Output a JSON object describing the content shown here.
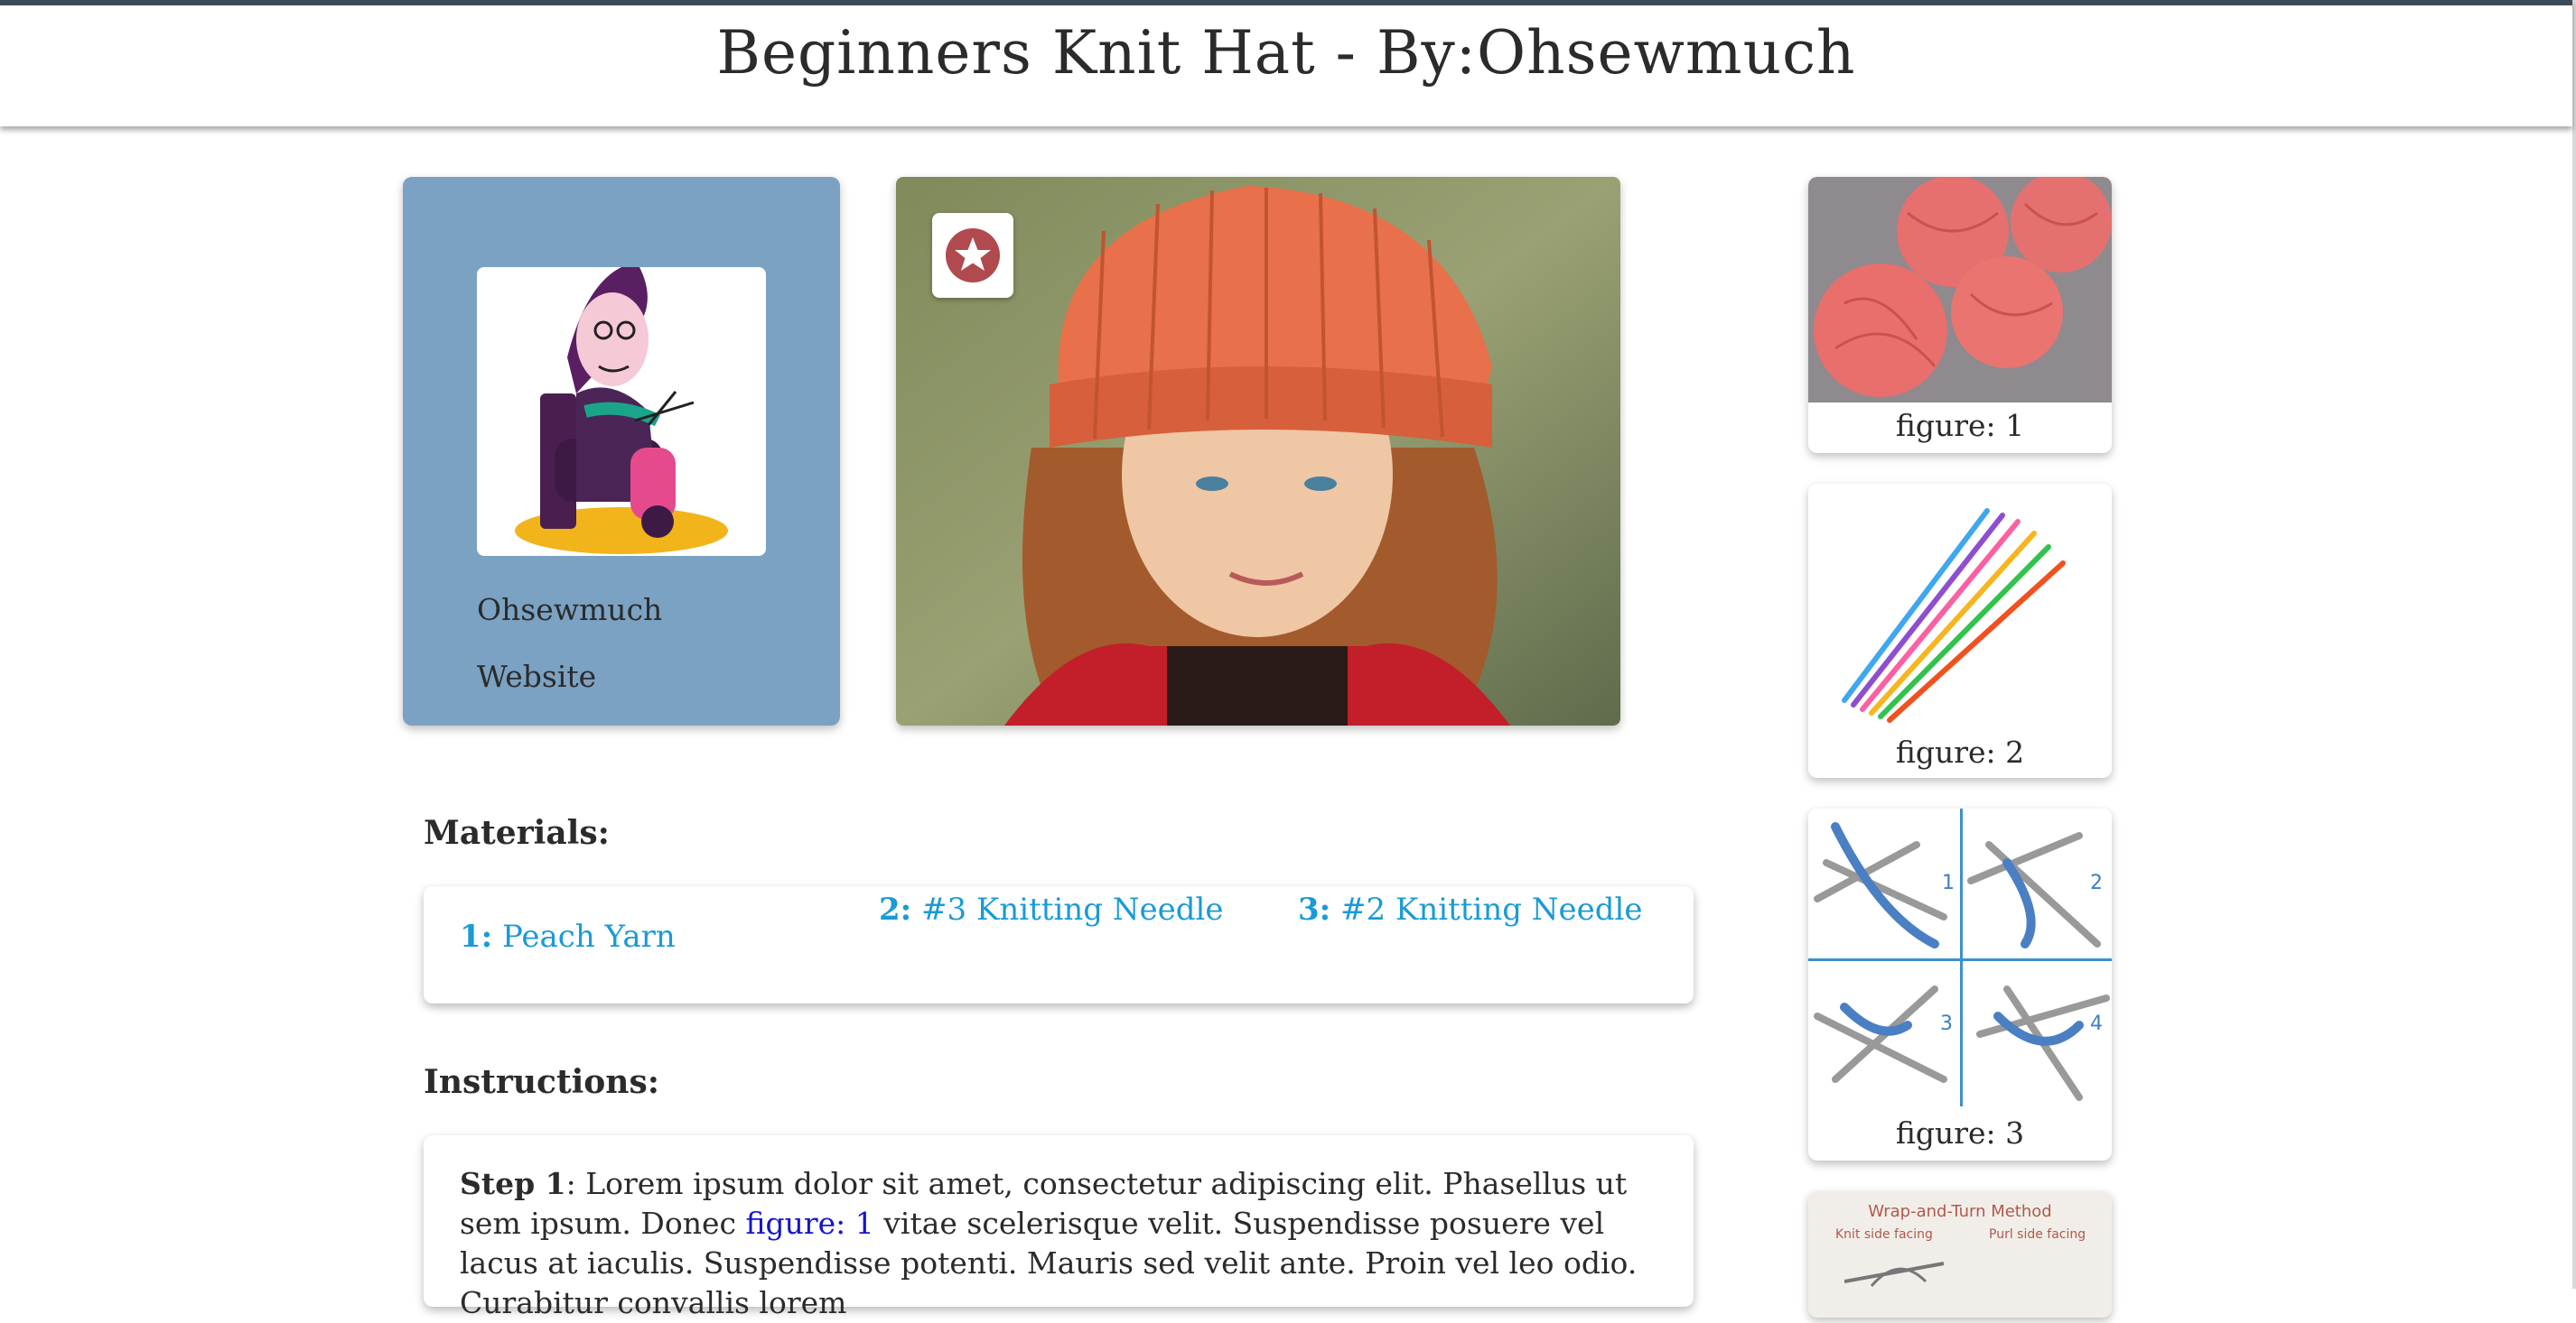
{
  "page": {
    "title": "Beginners Knit Hat - By:Ohsewmuch"
  },
  "profile": {
    "name": "Ohsewmuch",
    "website_label": "Website"
  },
  "hero": {
    "favorite_icon": "star-icon"
  },
  "materials": {
    "heading": "Materials:",
    "items": [
      {
        "number": "1:",
        "label": "Peach Yarn"
      },
      {
        "number": "2:",
        "label": "#3 Knitting Needle"
      },
      {
        "number": "3:",
        "label": "#2 Knitting Needle"
      }
    ]
  },
  "instructions": {
    "heading": "Instructions:",
    "step1": {
      "label": "Step 1",
      "text_a": ": Lorem ipsum dolor sit amet, consectetur adipiscing elit. Phasellus ut sem ipsum. Donec ",
      "link": "figure: 1",
      "text_b": " vitae scelerisque velit. Suspendisse posuere vel lacus at iaculis. Suspendisse potenti. Mauris sed velit ante. Proin vel leo odio. Curabitur convallis lorem"
    }
  },
  "figures": [
    {
      "caption": "figure: 1"
    },
    {
      "caption": "figure: 2"
    },
    {
      "caption": "figure: 3",
      "labels": [
        "1",
        "2",
        "3",
        "4"
      ]
    },
    {
      "title": "Wrap-and-Turn Method",
      "sub_left": "Knit side facing",
      "sub_right": "Purl side facing"
    }
  ],
  "colors": {
    "link": "#1a9ad6",
    "profile_bg": "#7ba2c2",
    "figure_link": "#1515cc"
  }
}
